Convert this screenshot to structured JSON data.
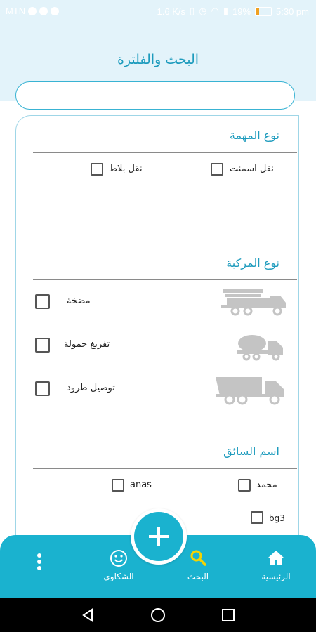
{
  "status_bar": {
    "carrier": "MTN",
    "network_speed": "1.6 K/s",
    "battery": "19%",
    "time": "5:30 pm"
  },
  "header": {
    "title": "البحث والفلترة"
  },
  "search": {
    "value": "",
    "placeholder": ""
  },
  "sections": {
    "task_type": {
      "title": "نوع المهمة",
      "options": [
        "نقل اسمنت",
        "نقل بلاط"
      ]
    },
    "vehicle_type": {
      "title": "نوع المركبة",
      "options": [
        {
          "label": "مضخة",
          "icon": "pump-truck-icon"
        },
        {
          "label": "تفريغ حمولة",
          "icon": "mixer-truck-icon"
        },
        {
          "label": "توصيل طرود",
          "icon": "dump-truck-icon"
        }
      ]
    },
    "driver_name": {
      "title": "اسم السائق",
      "options": [
        "محمد",
        "anas",
        "bg3"
      ]
    }
  },
  "bottom_nav": {
    "items": [
      "الرئيسية",
      "البحث",
      "الشكاوى"
    ],
    "fab_icon": "plus-icon",
    "more_icon": "more-vertical-icon"
  },
  "colors": {
    "accent": "#1ab2cf",
    "title": "#1d9bbd",
    "header_bg": "#e3f3fa"
  }
}
